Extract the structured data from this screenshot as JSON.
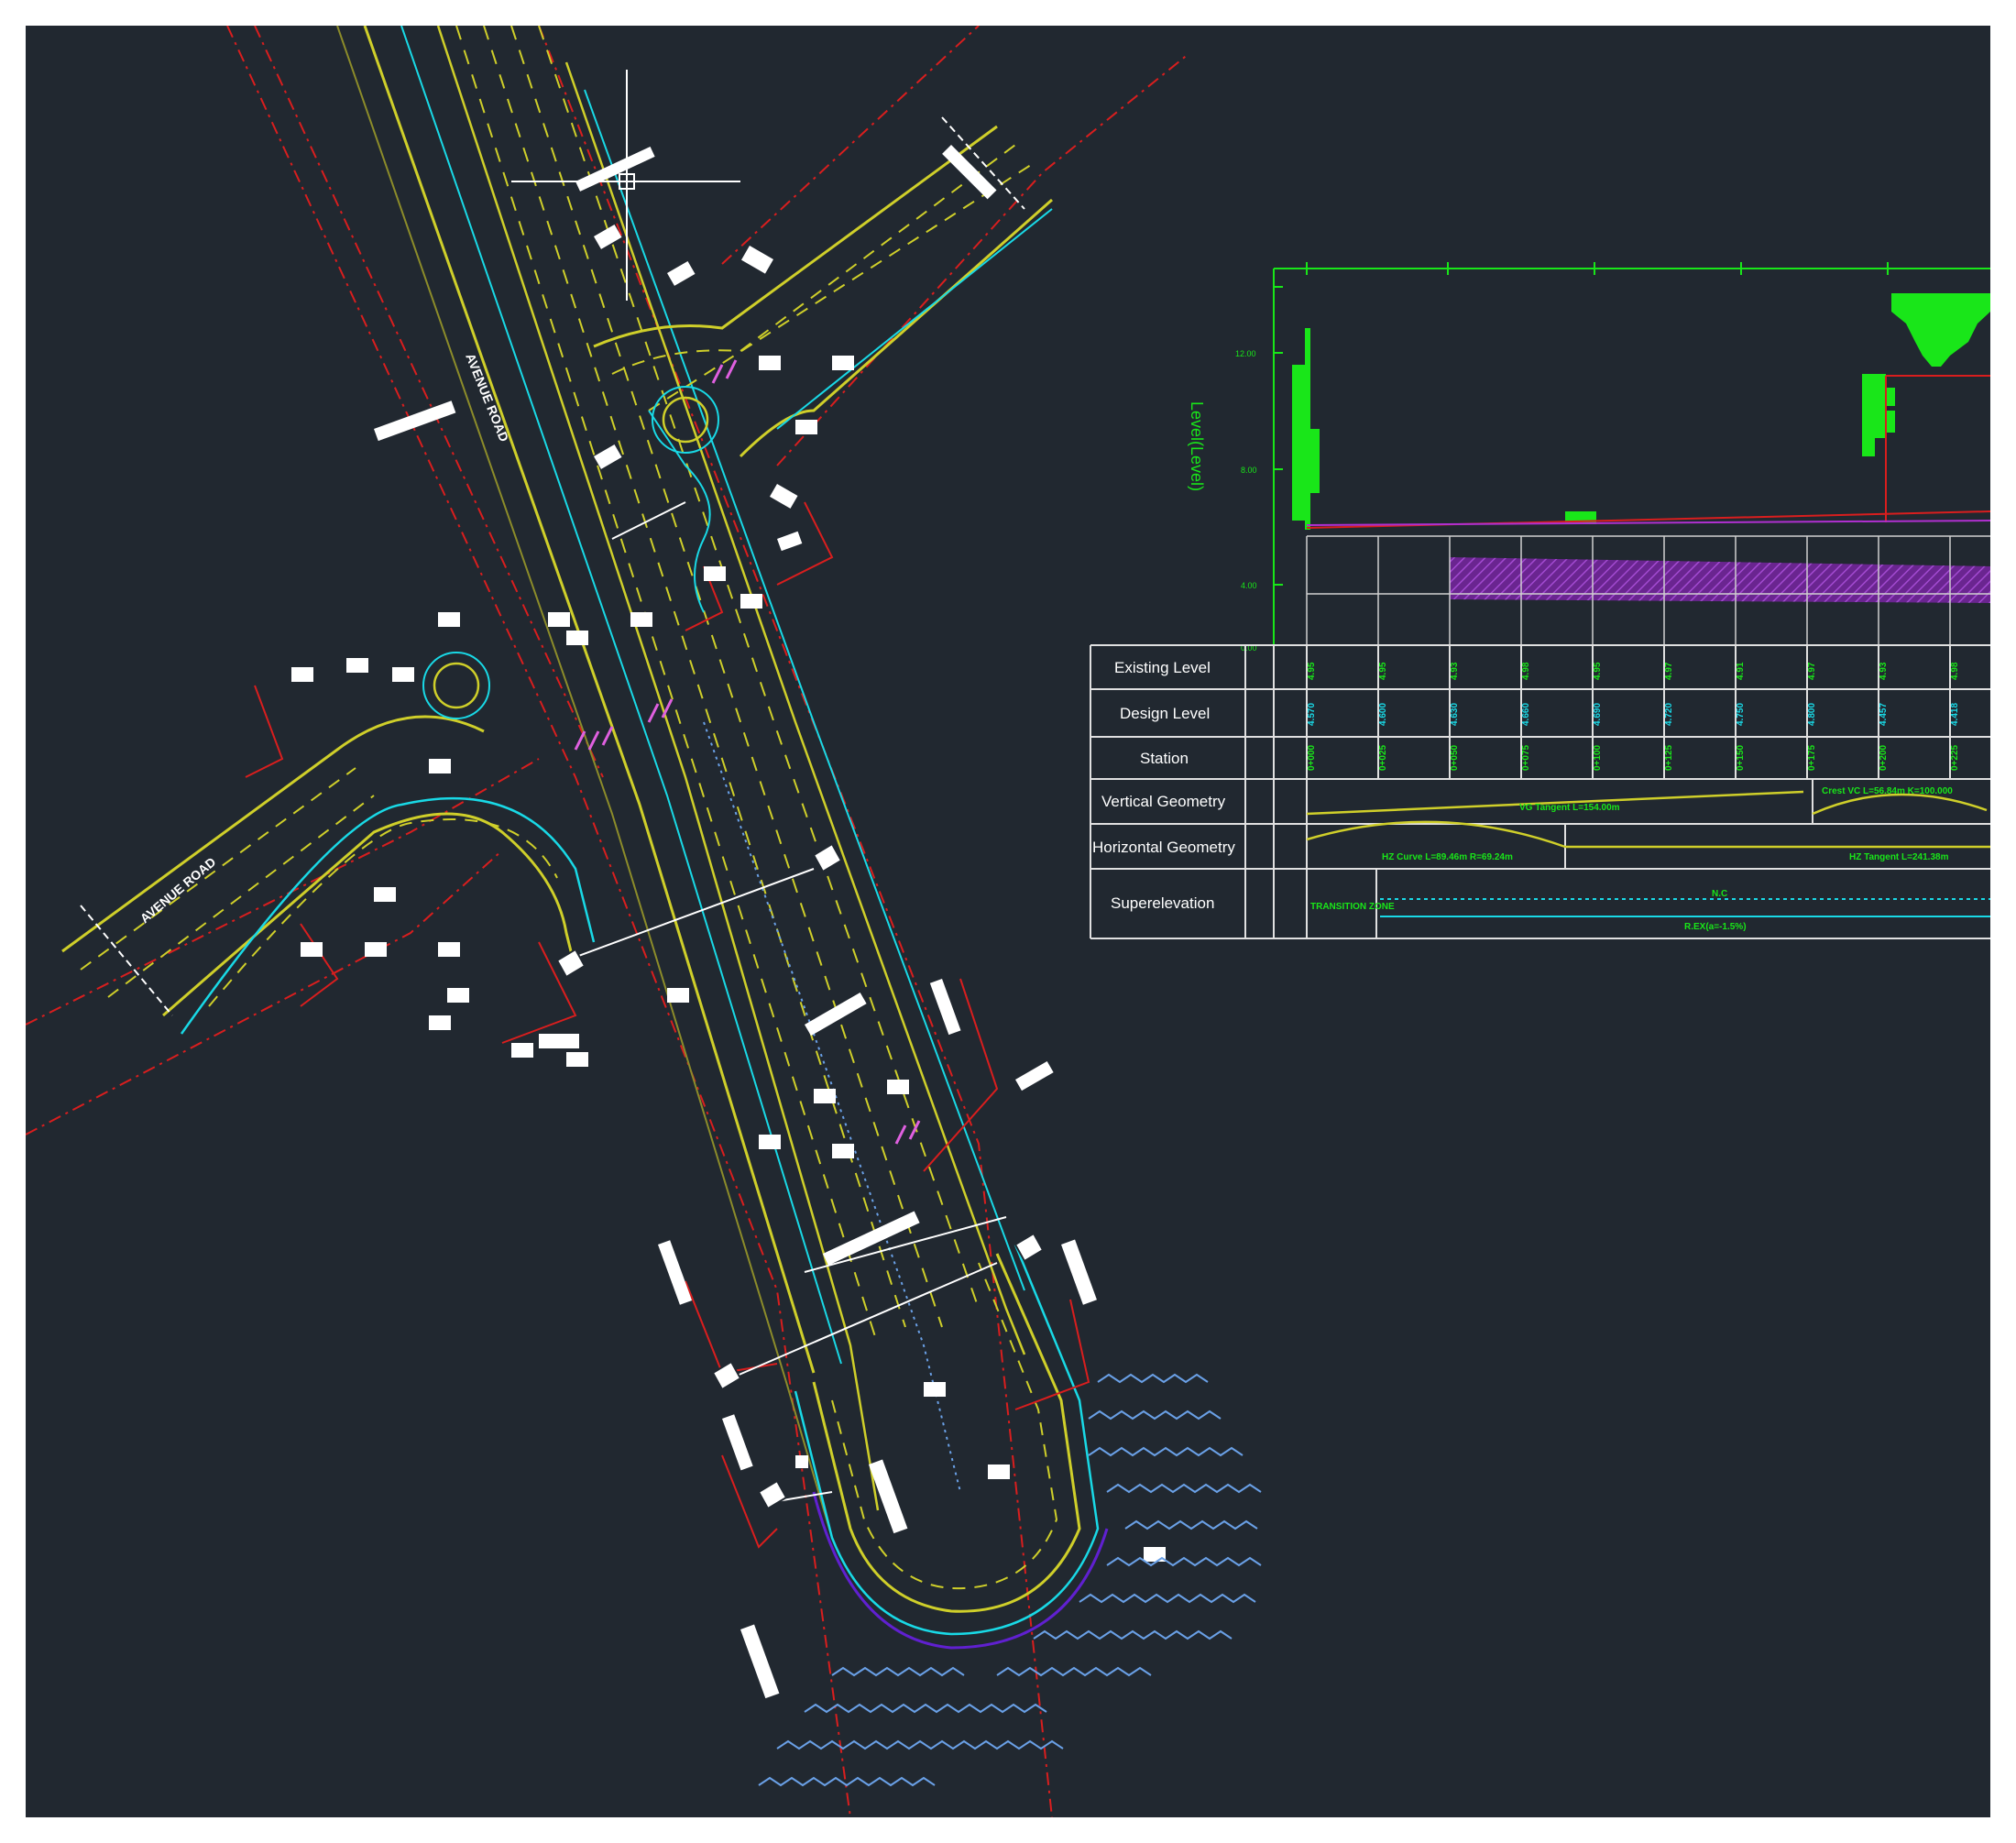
{
  "drawing": {
    "background": "#212830",
    "frame": "#ffffff",
    "colors": {
      "lane_yellow": "#cfcf2a",
      "edge_cyan": "#19d9e6",
      "row_red": "#d91e1e",
      "green": "#19e619",
      "purple": "#8a2fb0",
      "water_blue": "#6aa0e6",
      "white": "#ffffff",
      "olive": "#8c8c2a"
    },
    "plan": {
      "road_label_main": "AVENUE ROAD",
      "road_label_west": "AVENUE ROAD",
      "crosshair_icon": "cad-crosshair-icon"
    },
    "profile": {
      "axis_title": "Level(Level)",
      "axis_ticks": [
        "12.00",
        "8.00",
        "4.00",
        "0.00"
      ],
      "rows": [
        {
          "label": "Existing Level",
          "values": [
            "4.95",
            "4.95",
            "4.93",
            "4.98",
            "4.95",
            "4.97",
            "4.91",
            "4.97",
            "4.93",
            "4.98"
          ]
        },
        {
          "label": "Design Level",
          "values": [
            "4.570",
            "4.600",
            "4.630",
            "4.660",
            "4.690",
            "4.720",
            "4.750",
            "4.800",
            "4.457",
            "4.418"
          ]
        },
        {
          "label": "Station",
          "values": [
            "0+000",
            "0+025",
            "0+050",
            "0+075",
            "0+100",
            "0+125",
            "0+150",
            "0+175",
            "0+200",
            "0+225"
          ]
        },
        {
          "label": "Vertical Geometry",
          "notes": [
            "VG Tangent L=154.00m",
            "Crest VC L=56.84m K=100.000"
          ]
        },
        {
          "label": "Horizontal Geometry",
          "notes": [
            "HZ Curve L=89.46m R=69.24m",
            "HZ Tangent L=241.38m"
          ]
        },
        {
          "label": "Superelevation",
          "notes": [
            "TRANSITION ZONE",
            "N.C",
            "R.EX(a=-1.5%)"
          ]
        }
      ]
    }
  }
}
